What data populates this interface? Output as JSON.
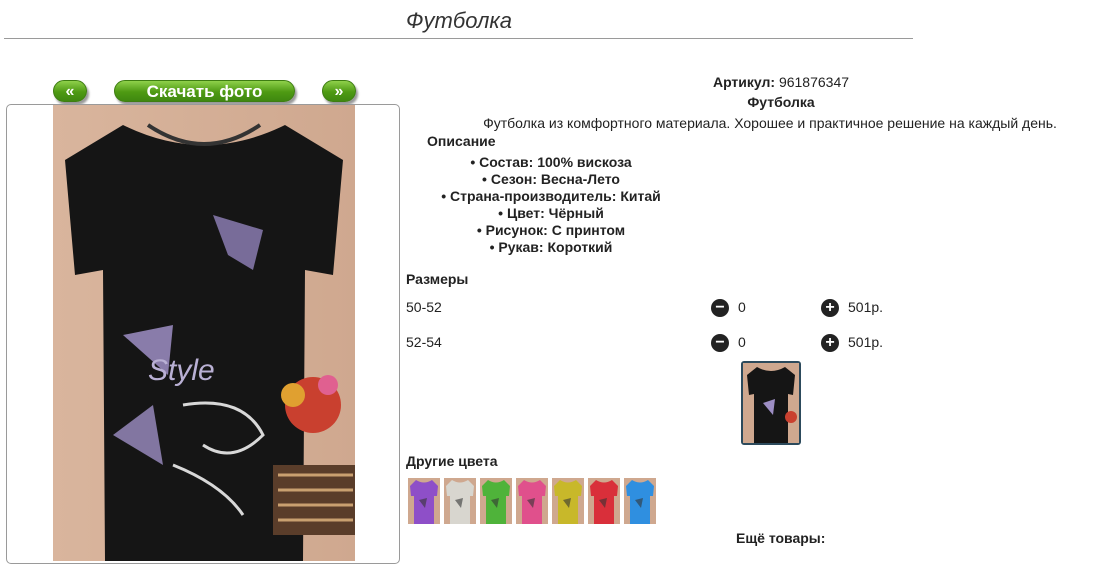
{
  "product": {
    "title": "Футболка",
    "article_label": "Артикул:",
    "article_value": "961876347",
    "name": "Футболка",
    "description": "Футболка из комфортного материала. Хорошее и практичное решение на каждый день."
  },
  "gallery": {
    "prev_label": "«",
    "download_label": "Скачать фото",
    "next_label": "»"
  },
  "description_section": {
    "heading": "Описание",
    "props": [
      "Состав: 100% вискоза",
      "Сезон: Весна-Лето",
      "Страна-производитель: Китай",
      "Цвет: Чёрный",
      "Рисунок: С принтом",
      "Рукав: Короткий"
    ]
  },
  "sizes": {
    "heading": "Размеры",
    "rows": [
      {
        "size": "50-52",
        "qty": "0",
        "price": "501р."
      },
      {
        "size": "52-54",
        "qty": "0",
        "price": "501р."
      }
    ]
  },
  "other_colors": {
    "heading": "Другие цвета",
    "swatches": [
      "#8e4fc8",
      "#d8d6cf",
      "#4fb33a",
      "#e0508c",
      "#c8b82a",
      "#d92f3a",
      "#2f8fe0"
    ]
  },
  "more_heading": "Ещё товары:",
  "icons": {
    "minus": "minus-circle-icon",
    "plus": "plus-circle-icon"
  }
}
